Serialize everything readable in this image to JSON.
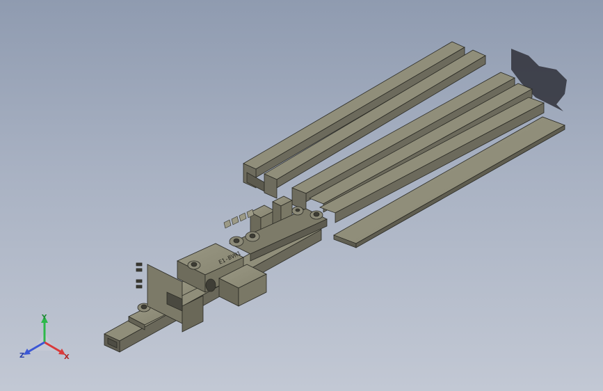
{
  "viewport": {
    "background_top": "#8f9bb0",
    "background_bottom": "#c2c8d4",
    "model_color": "#7d7b6b",
    "model_shadow_color": "#2f3038"
  },
  "part_engraving": {
    "label": "E1-BVH1"
  },
  "orientation_triad": {
    "y_label": "Y",
    "z_label": "Z",
    "x_label": "X",
    "y_color": "#2db84a",
    "z_color": "#3b57d6",
    "x_color": "#d93a3a"
  }
}
